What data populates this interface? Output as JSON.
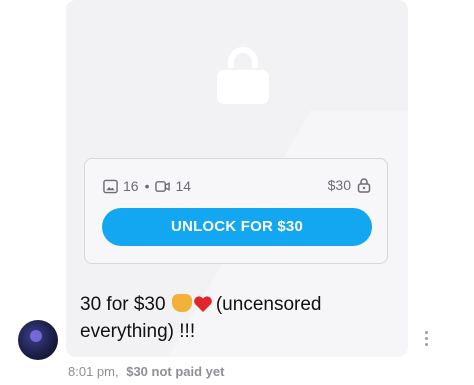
{
  "post": {
    "locked_price": "$30",
    "counts": {
      "images": "16",
      "separator": "•",
      "videos": "14"
    },
    "price_label": "$30",
    "unlock_button": "UNLOCK FOR $30",
    "message_part1": "30 for $30",
    "message_part2": "(uncensored everything) !!!",
    "time": "8:01 pm,",
    "payment_status": "$30 not paid yet"
  },
  "colors": {
    "accent": "#12a7f0",
    "card_bg": "#f2f2f4",
    "muted_text": "#8e9096"
  }
}
